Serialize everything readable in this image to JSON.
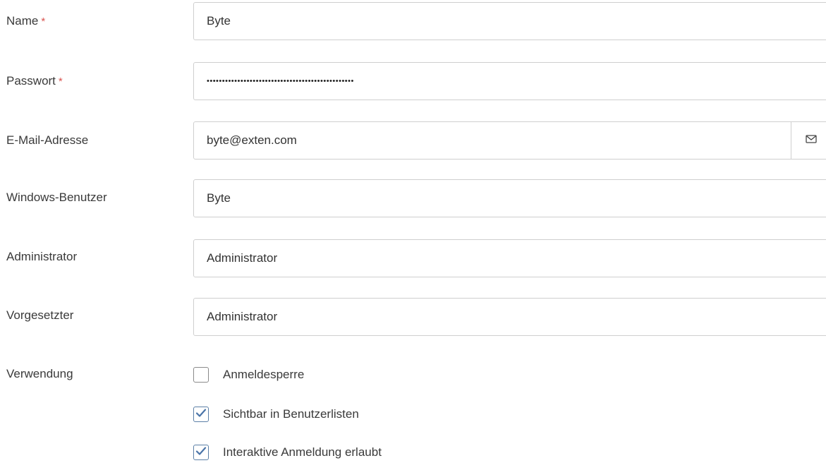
{
  "fields": {
    "name": {
      "label": "Name",
      "required_mark": "*",
      "value": "Byte"
    },
    "password": {
      "label": "Passwort",
      "required_mark": "*",
      "value": "••••••••••••••••••••••••••••••••••••••••••••••••"
    },
    "email": {
      "label": "E-Mail-Adresse",
      "value": "byte@exten.com",
      "addon_icon": "mail-icon"
    },
    "windows_user": {
      "label": "Windows-Benutzer",
      "value": "Byte"
    },
    "administrator": {
      "label": "Administrator",
      "value": "Administrator"
    },
    "supervisor": {
      "label": "Vorgesetzter",
      "value": "Administrator"
    }
  },
  "usage": {
    "label": "Verwendung",
    "options": [
      {
        "label": "Anmeldesperre",
        "checked": false
      },
      {
        "label": "Sichtbar in Benutzerlisten",
        "checked": true
      },
      {
        "label": "Interaktive Anmeldung erlaubt",
        "checked": true
      }
    ]
  },
  "colors": {
    "required": "#d9534f",
    "checkmark": "#4a74a8",
    "border": "#cfcfcf"
  }
}
